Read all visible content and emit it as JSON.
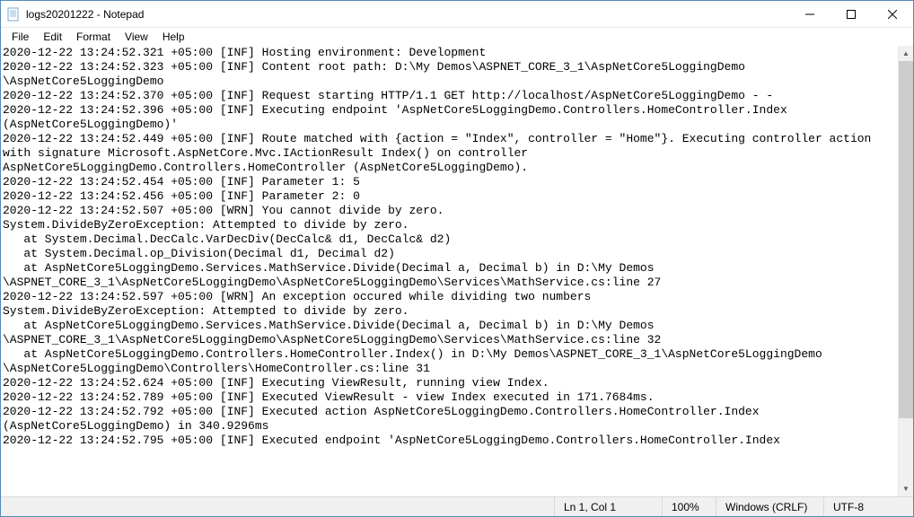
{
  "window": {
    "title": "logs20201222 - Notepad"
  },
  "menu": {
    "file": "File",
    "edit": "Edit",
    "format": "Format",
    "view": "View",
    "help": "Help"
  },
  "log_lines": [
    "2020-12-22 13:24:52.321 +05:00 [INF] Hosting environment: Development",
    "2020-12-22 13:24:52.323 +05:00 [INF] Content root path: D:\\My Demos\\ASPNET_CORE_3_1\\AspNetCore5LoggingDemo",
    "\\AspNetCore5LoggingDemo",
    "2020-12-22 13:24:52.370 +05:00 [INF] Request starting HTTP/1.1 GET http://localhost/AspNetCore5LoggingDemo - -",
    "2020-12-22 13:24:52.396 +05:00 [INF] Executing endpoint 'AspNetCore5LoggingDemo.Controllers.HomeController.Index ",
    "(AspNetCore5LoggingDemo)'",
    "2020-12-22 13:24:52.449 +05:00 [INF] Route matched with {action = \"Index\", controller = \"Home\"}. Executing controller action ",
    "with signature Microsoft.AspNetCore.Mvc.IActionResult Index() on controller ",
    "AspNetCore5LoggingDemo.Controllers.HomeController (AspNetCore5LoggingDemo).",
    "2020-12-22 13:24:52.454 +05:00 [INF] Parameter 1: 5",
    "2020-12-22 13:24:52.456 +05:00 [INF] Parameter 2: 0",
    "2020-12-22 13:24:52.507 +05:00 [WRN] You cannot divide by zero.",
    "System.DivideByZeroException: Attempted to divide by zero.",
    "   at System.Decimal.DecCalc.VarDecDiv(DecCalc& d1, DecCalc& d2)",
    "   at System.Decimal.op_Division(Decimal d1, Decimal d2)",
    "   at AspNetCore5LoggingDemo.Services.MathService.Divide(Decimal a, Decimal b) in D:\\My Demos",
    "\\ASPNET_CORE_3_1\\AspNetCore5LoggingDemo\\AspNetCore5LoggingDemo\\Services\\MathService.cs:line 27",
    "2020-12-22 13:24:52.597 +05:00 [WRN] An exception occured while dividing two numbers",
    "System.DivideByZeroException: Attempted to divide by zero.",
    "   at AspNetCore5LoggingDemo.Services.MathService.Divide(Decimal a, Decimal b) in D:\\My Demos",
    "\\ASPNET_CORE_3_1\\AspNetCore5LoggingDemo\\AspNetCore5LoggingDemo\\Services\\MathService.cs:line 32",
    "   at AspNetCore5LoggingDemo.Controllers.HomeController.Index() in D:\\My Demos\\ASPNET_CORE_3_1\\AspNetCore5LoggingDemo",
    "\\AspNetCore5LoggingDemo\\Controllers\\HomeController.cs:line 31",
    "2020-12-22 13:24:52.624 +05:00 [INF] Executing ViewResult, running view Index.",
    "2020-12-22 13:24:52.789 +05:00 [INF] Executed ViewResult - view Index executed in 171.7684ms.",
    "2020-12-22 13:24:52.792 +05:00 [INF] Executed action AspNetCore5LoggingDemo.Controllers.HomeController.Index ",
    "(AspNetCore5LoggingDemo) in 340.9296ms",
    "2020-12-22 13:24:52.795 +05:00 [INF] Executed endpoint 'AspNetCore5LoggingDemo.Controllers.HomeController.Index "
  ],
  "status": {
    "position": "Ln 1, Col 1",
    "zoom": "100%",
    "line_ending": "Windows (CRLF)",
    "encoding": "UTF-8"
  }
}
